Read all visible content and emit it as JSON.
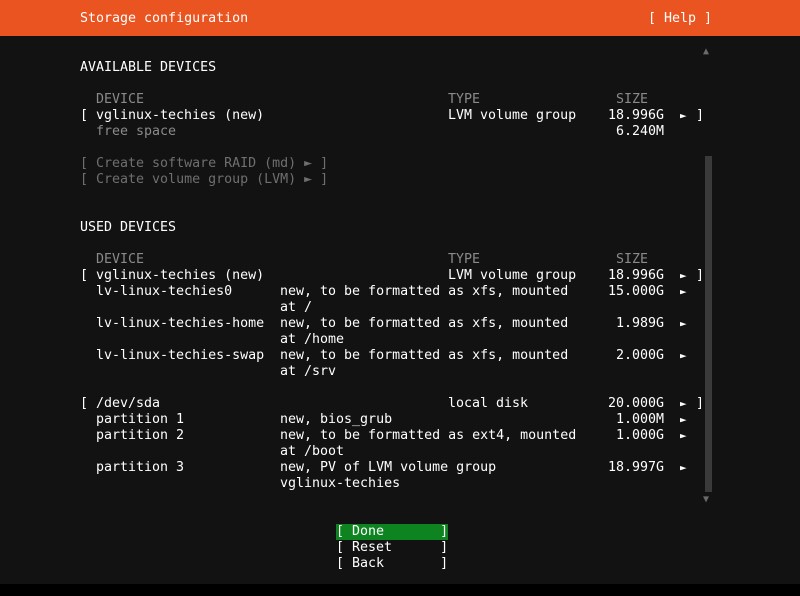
{
  "header": {
    "title": "Storage configuration",
    "help": "[ Help ]"
  },
  "available": {
    "section": "AVAILABLE DEVICES",
    "columns": {
      "device": "DEVICE",
      "type": "TYPE",
      "size": "SIZE"
    },
    "vg": {
      "bracket": "[",
      "name": "vglinux-techies (new)",
      "type": "LVM volume group",
      "size": "18.996G",
      "action": "►",
      "close": "]"
    },
    "free": {
      "label": "free space",
      "size": "6.240M"
    },
    "raid": "[ Create software RAID (md) ► ]",
    "vgcreate": "[ Create volume group (LVM) ► ]"
  },
  "used": {
    "section": "USED DEVICES",
    "columns": {
      "device": "DEVICE",
      "type": "TYPE",
      "size": "SIZE"
    },
    "vg": {
      "bracket": "[",
      "name": "vglinux-techies (new)",
      "type": "LVM volume group",
      "size": "18.996G",
      "action": "►",
      "close": "]"
    },
    "lvs": [
      {
        "name": "lv-linux-techies0",
        "desc": "new, to be formatted as xfs, mounted",
        "desc2": "at /",
        "size": "15.000G",
        "action": "►"
      },
      {
        "name": "lv-linux-techies-home",
        "desc": "new, to be formatted as xfs, mounted",
        "desc2": "at /home",
        "size": "1.989G",
        "action": "►"
      },
      {
        "name": "lv-linux-techies-swap",
        "desc": "new, to be formatted as xfs, mounted",
        "desc2": "at /srv",
        "size": "2.000G",
        "action": "►"
      }
    ],
    "disk": {
      "bracket": "[",
      "name": "/dev/sda",
      "type": "local disk",
      "size": "20.000G",
      "action": "►",
      "close": "]"
    },
    "partitions": [
      {
        "name": "partition 1",
        "desc": "new, bios_grub",
        "desc2": "",
        "size": "1.000M",
        "action": "►"
      },
      {
        "name": "partition 2",
        "desc": "new, to be formatted as ext4, mounted",
        "desc2": "at /boot",
        "size": "1.000G",
        "action": "►"
      },
      {
        "name": "partition 3",
        "desc": "new, PV of LVM volume group",
        "desc2": "vglinux-techies",
        "size": "18.997G",
        "action": "►"
      }
    ]
  },
  "scrollbar": {
    "up": "▲",
    "down": "▼"
  },
  "buttons": {
    "done": "[ Done       ]",
    "reset": "[ Reset      ]",
    "back": "[ Back       ]"
  },
  "colors": {
    "header_bg": "#e95420",
    "focus_bg": "#0e8420",
    "panel_bg": "#121212"
  }
}
